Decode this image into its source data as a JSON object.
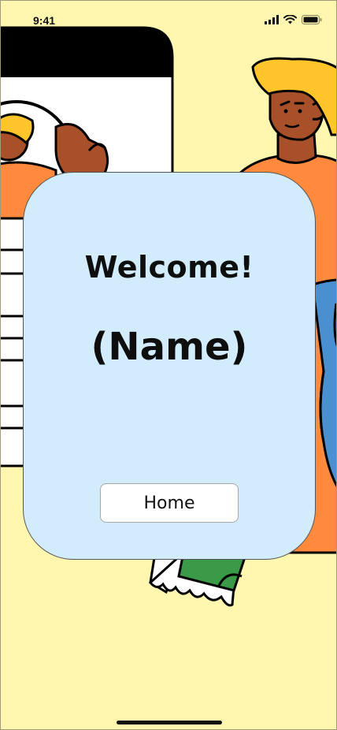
{
  "status_bar": {
    "time": "9:41",
    "icons": [
      "cellular-signal-icon",
      "wifi-icon",
      "battery-icon"
    ]
  },
  "welcome_card": {
    "title": "Welcome!",
    "name": "(Name)",
    "home_button_label": "Home"
  },
  "colors": {
    "background": "#fff7b0",
    "card": "#d2ecfb",
    "button": "#ffffff",
    "text": "#0e0e0e"
  }
}
